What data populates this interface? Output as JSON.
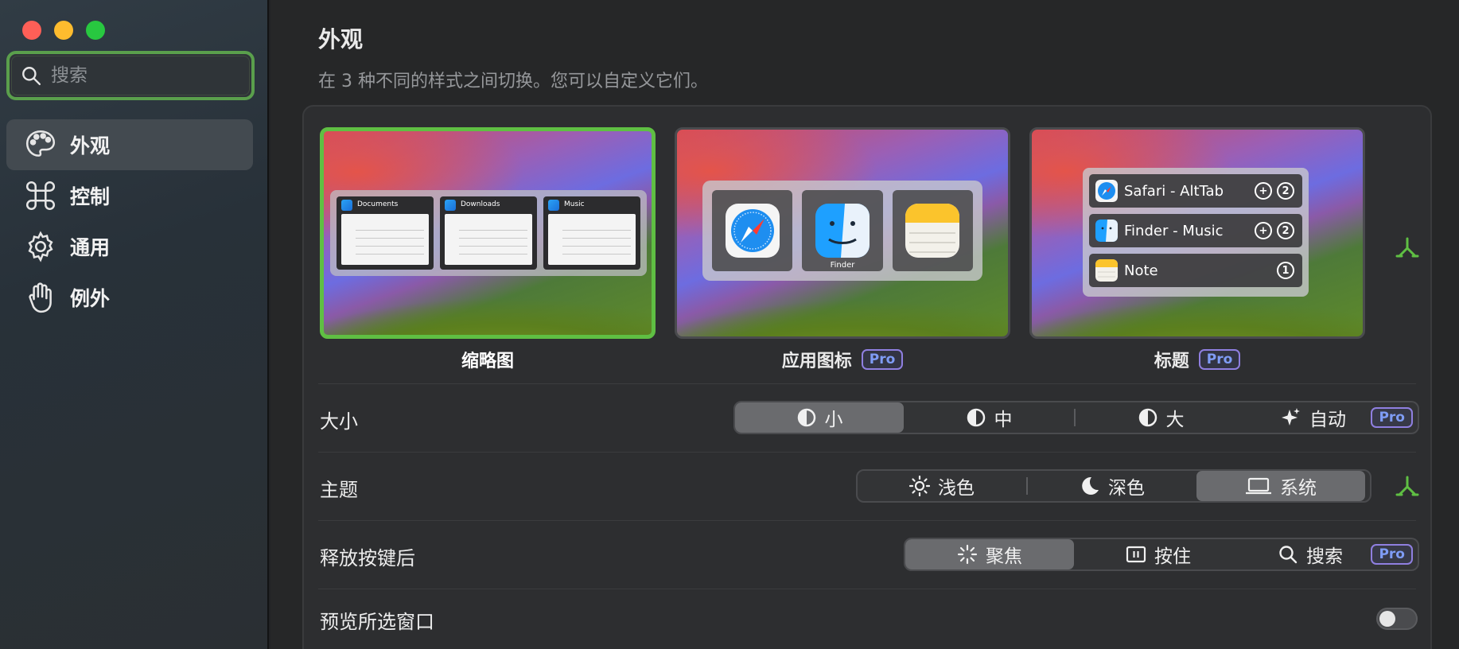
{
  "window": {
    "traffic_lights": [
      {
        "name": "close",
        "color": "#fe5f57"
      },
      {
        "name": "minimize",
        "color": "#febc2e"
      },
      {
        "name": "zoom",
        "color": "#28c840"
      }
    ]
  },
  "sidebar": {
    "search": {
      "placeholder": "搜索",
      "icon": "search-icon"
    },
    "items": [
      {
        "label": "外观",
        "icon": "palette-icon",
        "active": true
      },
      {
        "label": "控制",
        "icon": "command-icon",
        "active": false
      },
      {
        "label": "通用",
        "icon": "gear-icon",
        "active": false
      },
      {
        "label": "例外",
        "icon": "hand-icon",
        "active": false
      }
    ]
  },
  "main": {
    "title": "外观",
    "subtitle": "在 3 种不同的样式之间切换。您可以自定义它们。",
    "styles": [
      {
        "label": "缩略图",
        "selected": true,
        "pro": false,
        "thumbnails": [
          "Documents",
          "Downloads",
          "Music"
        ]
      },
      {
        "label": "应用图标",
        "selected": false,
        "pro": true,
        "pro_label": "Pro",
        "app_caption": "Finder"
      },
      {
        "label": "标题",
        "selected": false,
        "pro": true,
        "pro_label": "Pro",
        "rows": [
          {
            "title": "Safari - AltTab",
            "count": "2"
          },
          {
            "title": "Finder - Music",
            "count": "2"
          },
          {
            "title": "Note",
            "count": "1"
          }
        ]
      }
    ],
    "settings": {
      "size": {
        "label": "大小",
        "options": [
          "小",
          "中",
          "大",
          "自动"
        ],
        "selected": "小",
        "pro_label": "Pro"
      },
      "theme": {
        "label": "主题",
        "options": [
          "浅色",
          "深色",
          "系统"
        ],
        "selected": "系统"
      },
      "release": {
        "label": "释放按键后",
        "options": [
          "聚焦",
          "按住",
          "搜索"
        ],
        "selected": "聚焦",
        "pro_label": "Pro"
      },
      "preview_window": {
        "label": "预览所选窗口",
        "enabled": false
      }
    }
  },
  "colors": {
    "accent_green": "#5fbf43",
    "pro_blue": "#7f9cf5",
    "selected_segment": "#6a6b6e"
  }
}
